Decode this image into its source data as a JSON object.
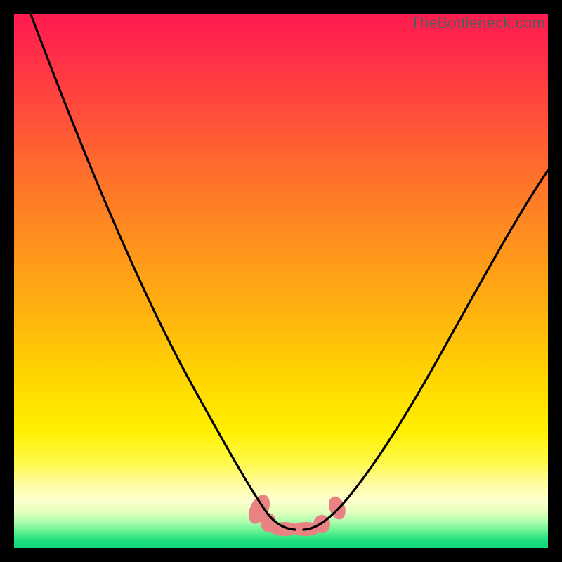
{
  "attribution": "TheBottleneck.com",
  "colors": {
    "gradient_top": "#ff1a4f",
    "gradient_mid": "#ffd500",
    "gradient_bottom": "#10d878",
    "curve": "#000000",
    "accent_blob": "#e98282",
    "frame": "#000000"
  },
  "chart_data": {
    "type": "line",
    "title": "",
    "xlabel": "",
    "ylabel": "",
    "x_range": [
      0,
      100
    ],
    "y_range": [
      0,
      100
    ],
    "grid": false,
    "legend": false,
    "note": "Values estimated from pixel positions; y=0 at bottom, y=100 at top. Two convex curves meeting in a V near the bottom; salmon dots mark the trough.",
    "series": [
      {
        "name": "left-curve",
        "x": [
          3,
          10,
          18,
          26,
          33,
          39,
          44,
          47,
          49,
          51,
          54
        ],
        "y": [
          100,
          80,
          60,
          42,
          28,
          18,
          11,
          7,
          5,
          4,
          4
        ]
      },
      {
        "name": "right-curve",
        "x": [
          55,
          58,
          61,
          66,
          72,
          80,
          88,
          95,
          100
        ],
        "y": [
          4,
          5,
          7,
          12,
          22,
          38,
          55,
          68,
          75
        ]
      },
      {
        "name": "trough-markers",
        "style": "blob",
        "x": [
          46,
          48,
          50,
          53,
          56,
          58,
          61
        ],
        "y": [
          7,
          5,
          4,
          4,
          4,
          5,
          8
        ]
      }
    ]
  }
}
